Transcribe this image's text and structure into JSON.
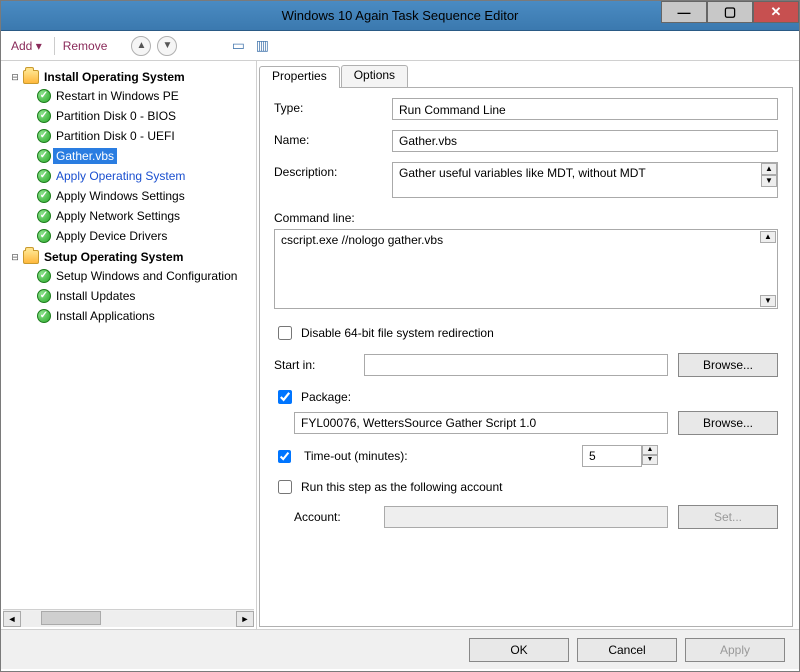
{
  "window": {
    "title": "Windows 10 Again Task Sequence Editor"
  },
  "toolbar": {
    "add": "Add",
    "remove": "Remove"
  },
  "tree": {
    "group1": {
      "label": "Install Operating System",
      "items": [
        "Restart in Windows PE",
        "Partition Disk 0 - BIOS",
        "Partition Disk 0 - UEFI",
        "Gather.vbs",
        "Apply Operating System",
        "Apply Windows Settings",
        "Apply Network Settings",
        "Apply Device Drivers"
      ]
    },
    "group2": {
      "label": "Setup Operating System",
      "items": [
        "Setup Windows and Configuration",
        "Install Updates",
        "Install Applications"
      ]
    }
  },
  "tabs": {
    "properties": "Properties",
    "options": "Options"
  },
  "props": {
    "type_label": "Type:",
    "type_value": "Run Command Line",
    "name_label": "Name:",
    "name_value": "Gather.vbs",
    "desc_label": "Description:",
    "desc_value": "Gather useful variables like MDT, without MDT",
    "cmd_label": "Command line:",
    "cmd_value": "cscript.exe  //nologo  gather.vbs",
    "disable64_label": "Disable 64-bit file system redirection",
    "startin_label": "Start in:",
    "startin_value": "",
    "browse": "Browse...",
    "package_label": "Package:",
    "package_value": "FYL00076, WettersSource Gather Script 1.0",
    "timeout_label": "Time-out (minutes):",
    "timeout_value": "5",
    "runas_label": "Run this step as the following account",
    "account_label": "Account:",
    "account_value": "",
    "set_btn": "Set..."
  },
  "buttons": {
    "ok": "OK",
    "cancel": "Cancel",
    "apply": "Apply"
  }
}
